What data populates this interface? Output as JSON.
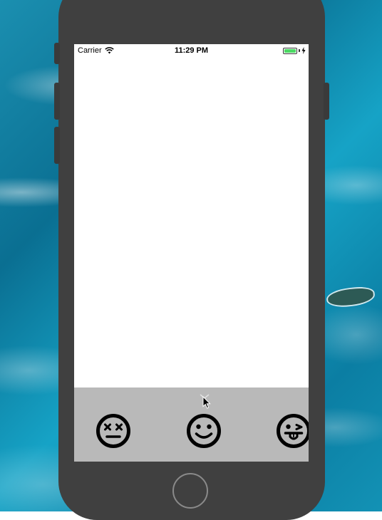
{
  "status_bar": {
    "carrier": "Carrier",
    "time": "11:29 PM",
    "battery_level": 1.0,
    "battery_color": "#4cd964",
    "icons": [
      "wifi-icon",
      "battery-icon",
      "charging-bolt-icon"
    ]
  },
  "bottom_panel": {
    "background": "#b9b9b9",
    "emojis": [
      {
        "icon": "dizzy-face-icon"
      },
      {
        "icon": "smiling-face-icon"
      },
      {
        "icon": "tongue-out-face-icon"
      }
    ]
  }
}
